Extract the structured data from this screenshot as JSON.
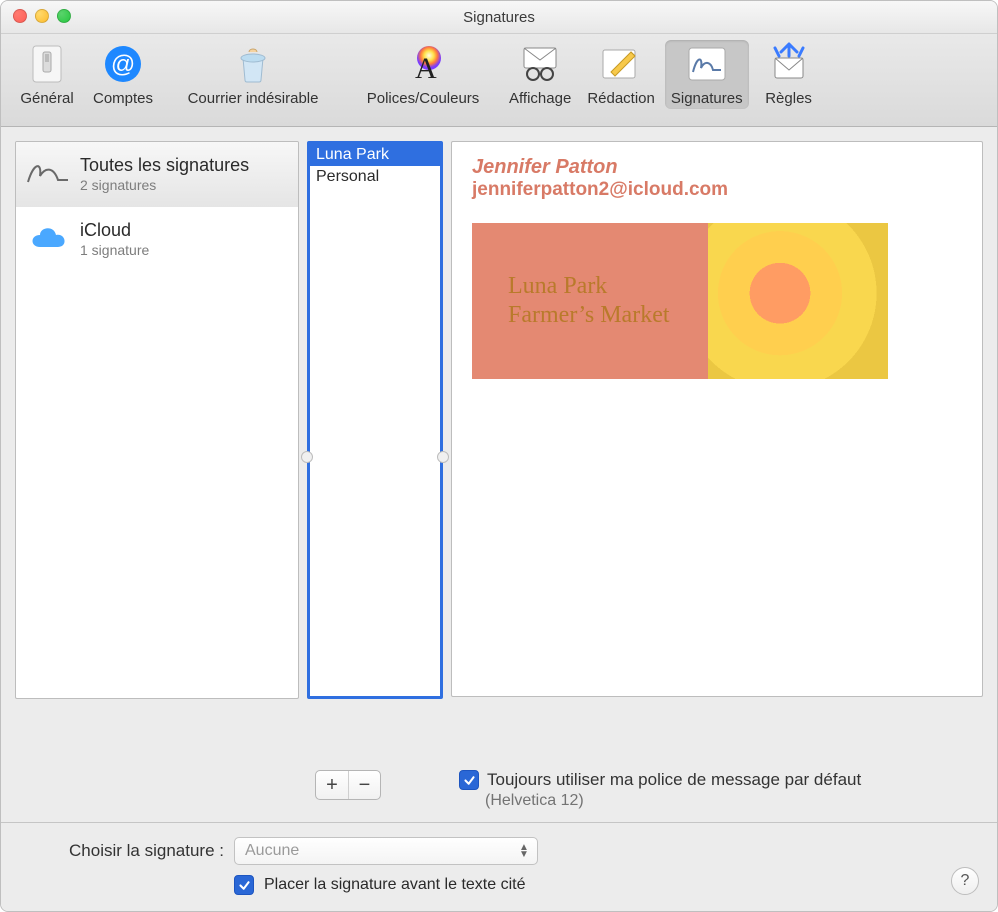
{
  "window": {
    "title": "Signatures"
  },
  "toolbar": {
    "items": [
      {
        "id": "general",
        "label": "Général"
      },
      {
        "id": "accounts",
        "label": "Comptes"
      },
      {
        "id": "junk",
        "label": "Courrier indésirable"
      },
      {
        "id": "fonts",
        "label": "Polices/Couleurs"
      },
      {
        "id": "viewing",
        "label": "Affichage"
      },
      {
        "id": "compose",
        "label": "Rédaction"
      },
      {
        "id": "signatures",
        "label": "Signatures"
      },
      {
        "id": "rules",
        "label": "Règles"
      }
    ],
    "selected": "signatures"
  },
  "accounts": [
    {
      "id": "all",
      "title": "Toutes les signatures",
      "sub": "2 signatures",
      "selected": true
    },
    {
      "id": "icloud",
      "title": "iCloud",
      "sub": "1 signature",
      "selected": false
    }
  ],
  "signatures": {
    "items": [
      "Luna Park",
      "Personal"
    ],
    "selected_index": 0
  },
  "preview": {
    "name": "Jennifer Patton",
    "email": "jenniferpatton2@icloud.com",
    "image_line1": "Luna Park",
    "image_line2": "Farmer’s Market"
  },
  "controls": {
    "add_title": "+",
    "remove_title": "−",
    "use_default_font_label": "Toujours utiliser ma police de message par défaut",
    "use_default_font_checked": true,
    "font_note": "(Helvetica 12)",
    "choose_signature_label": "Choisir la signature :",
    "choose_signature_value": "Aucune",
    "place_before_quoted_label": "Placer la signature avant le texte cité",
    "place_before_quoted_checked": true,
    "help": "?"
  }
}
